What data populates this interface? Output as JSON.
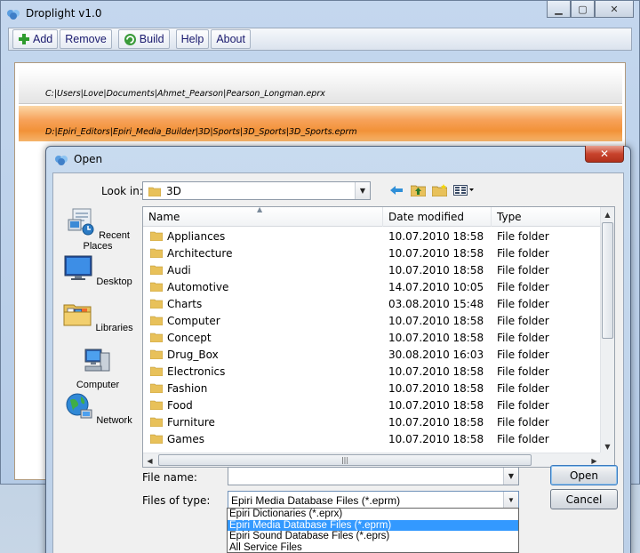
{
  "app": {
    "title": "Droplight v1.0"
  },
  "toolbar": {
    "add_label": "Add",
    "remove_label": "Remove",
    "build_label": "Build",
    "help_label": "Help",
    "about_label": "About"
  },
  "project_files": [
    "C:|Users|Love|Documents|Ahmet_Pearson|Pearson_Longman.eprx",
    "D:|Epiri_Editors|Epiri_Media_Builder|3D|Sports|3D_Sports|3D_Sports.eprm"
  ],
  "dialog": {
    "title": "Open",
    "look_in_label": "Look in:",
    "look_in_value": "3D",
    "places": [
      {
        "label": "Recent Places",
        "icon": "recent-places-icon"
      },
      {
        "label": "Desktop",
        "icon": "desktop-icon"
      },
      {
        "label": "Libraries",
        "icon": "libraries-icon"
      },
      {
        "label": "Computer",
        "icon": "computer-icon"
      },
      {
        "label": "Network",
        "icon": "network-icon"
      }
    ],
    "columns": {
      "name": "Name",
      "date": "Date modified",
      "type": "Type"
    },
    "rows": [
      {
        "name": "Appliances",
        "date": "10.07.2010 18:58",
        "type": "File folder"
      },
      {
        "name": "Architecture",
        "date": "10.07.2010 18:58",
        "type": "File folder"
      },
      {
        "name": "Audi",
        "date": "10.07.2010 18:58",
        "type": "File folder"
      },
      {
        "name": "Automotive",
        "date": "14.07.2010 10:05",
        "type": "File folder"
      },
      {
        "name": "Charts",
        "date": "03.08.2010 15:48",
        "type": "File folder"
      },
      {
        "name": "Computer",
        "date": "10.07.2010 18:58",
        "type": "File folder"
      },
      {
        "name": "Concept",
        "date": "10.07.2010 18:58",
        "type": "File folder"
      },
      {
        "name": "Drug_Box",
        "date": "30.08.2010 16:03",
        "type": "File folder"
      },
      {
        "name": "Electronics",
        "date": "10.07.2010 18:58",
        "type": "File folder"
      },
      {
        "name": "Fashion",
        "date": "10.07.2010 18:58",
        "type": "File folder"
      },
      {
        "name": "Food",
        "date": "10.07.2010 18:58",
        "type": "File folder"
      },
      {
        "name": "Furniture",
        "date": "10.07.2010 18:58",
        "type": "File folder"
      },
      {
        "name": "Games",
        "date": "10.07.2010 18:58",
        "type": "File folder"
      }
    ],
    "file_name_label": "File name:",
    "file_name_value": "",
    "files_of_type_label": "Files of type:",
    "files_of_type_value": "Epiri Media Database Files (*.eprm)",
    "open_label": "Open",
    "cancel_label": "Cancel",
    "type_options": [
      "Epiri Dictionaries (*.eprx)",
      "Epiri Media Database Files (*.eprm)",
      "Epiri Sound Database Files (*.eprs)",
      "All Service Files"
    ],
    "selected_type_index": 1
  },
  "colors": {
    "selected_row": "#f29238",
    "dropdown_highlight": "#3399ff",
    "folder": "#e8c15a"
  }
}
